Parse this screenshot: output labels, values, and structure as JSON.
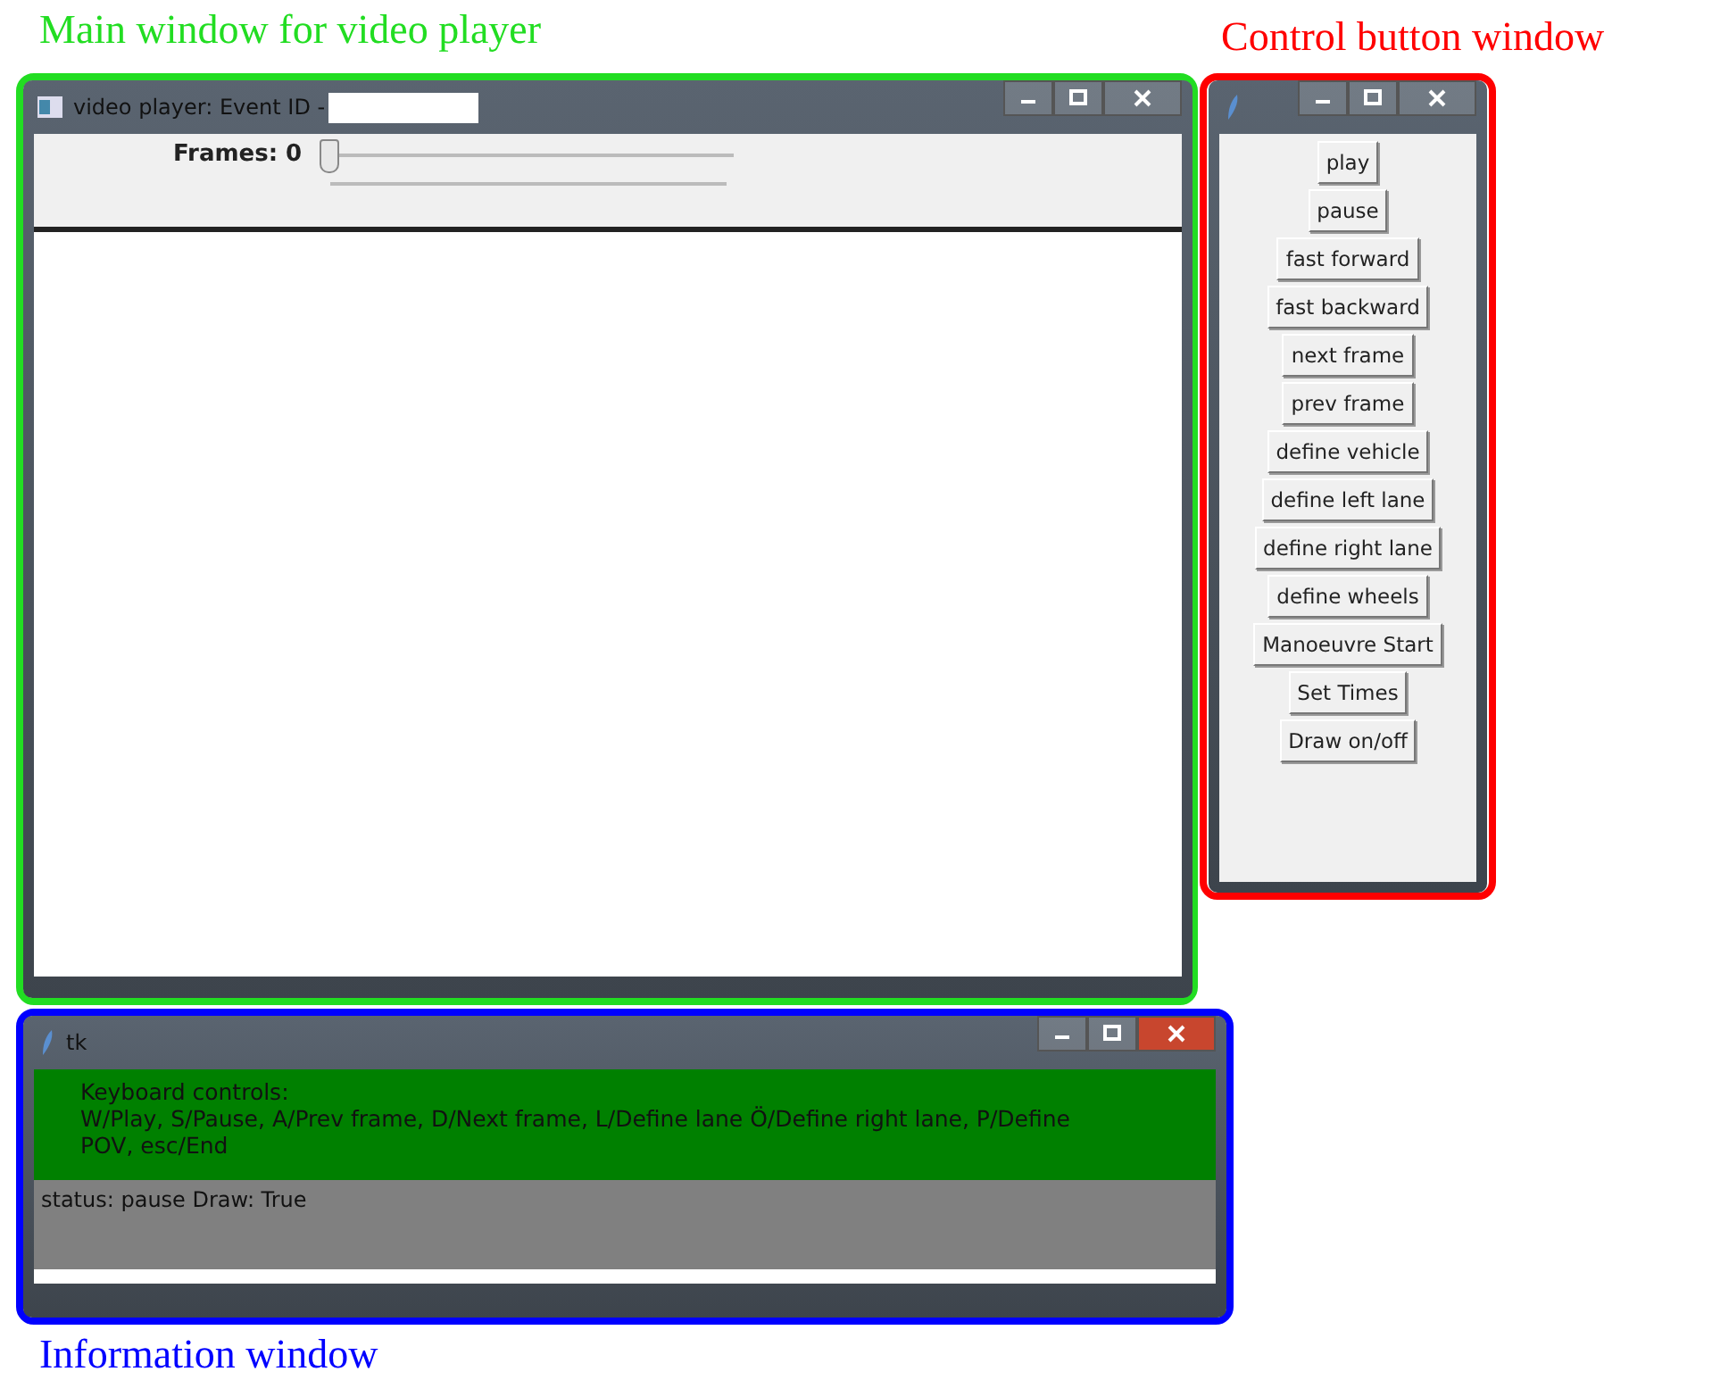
{
  "annotations": [
    {
      "text": "Main window for video player",
      "color": "#22dd22"
    },
    {
      "text": "Control button window",
      "color": "#ff0000"
    },
    {
      "text": "Information window",
      "color": "#0000ff"
    }
  ],
  "main_window": {
    "title": "video player: Event ID -",
    "frames_label": "Frames: 0",
    "slider": {
      "level": 0
    }
  },
  "control_window": {
    "buttons": [
      "play",
      "pause",
      "fast forward",
      "fast backward",
      "next frame",
      "prev frame",
      "define vehicle",
      "define left lane",
      "define right lane",
      "define wheels",
      "Manoeuvre Start",
      "Set Times",
      "Draw on/off"
    ]
  },
  "info_window": {
    "title": "tk",
    "heading": "Keyboard controls:",
    "keys": "W/Play, S/Pause, A/Prev frame, D/Next frame, L/Define lane Ö/Define right lane, P/Define POV, esc/End",
    "status": "status: pause Draw: True"
  }
}
